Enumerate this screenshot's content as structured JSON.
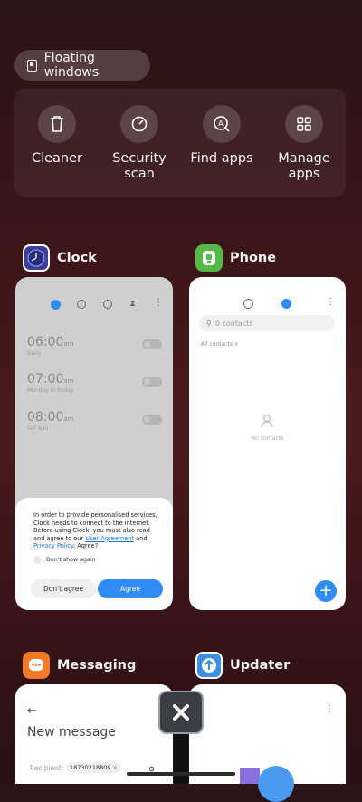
{
  "floating": {
    "label": "Floating windows"
  },
  "tools": [
    {
      "label": "Cleaner",
      "icon": "trash-icon"
    },
    {
      "label": "Security scan",
      "icon": "security-scan-icon"
    },
    {
      "label": "Find apps",
      "icon": "find-apps-icon"
    },
    {
      "label": "Manage apps",
      "icon": "manage-apps-icon"
    }
  ],
  "clock": {
    "title": "Clock",
    "alarms": [
      {
        "time": "06:00",
        "ampm": "am",
        "sub": "Daily"
      },
      {
        "time": "07:00",
        "ampm": "am",
        "sub": "Monday to Friday"
      },
      {
        "time": "08:00",
        "ampm": "am",
        "sub": "Set Sun"
      }
    ],
    "dialog": {
      "text": "In order to provide personalised services, Clock needs to connect to the internet. Before using Clock, you must also read and agree to our",
      "link1": "User Agreement",
      "and": "and",
      "link2": "Privacy Policy",
      "agree_q": ". Agree?",
      "checkbox": "Don't show again",
      "btn_no": "Don't agree",
      "btn_yes": "Agree"
    }
  },
  "phone": {
    "title": "Phone",
    "search_placeholder": "0 contacts",
    "filter": "All contacts",
    "empty": "No contacts"
  },
  "messaging": {
    "title": "Messaging",
    "header": "New message",
    "recipient_label": "Recipient:",
    "recipient_value": "18730218809"
  },
  "updater": {
    "title": "Updater"
  },
  "colors": {
    "accent_blue": "#2f8cf5",
    "clock_orange": "#f07a28",
    "phone_green": "#56b847",
    "updater_blue": "#3c8fe0"
  }
}
